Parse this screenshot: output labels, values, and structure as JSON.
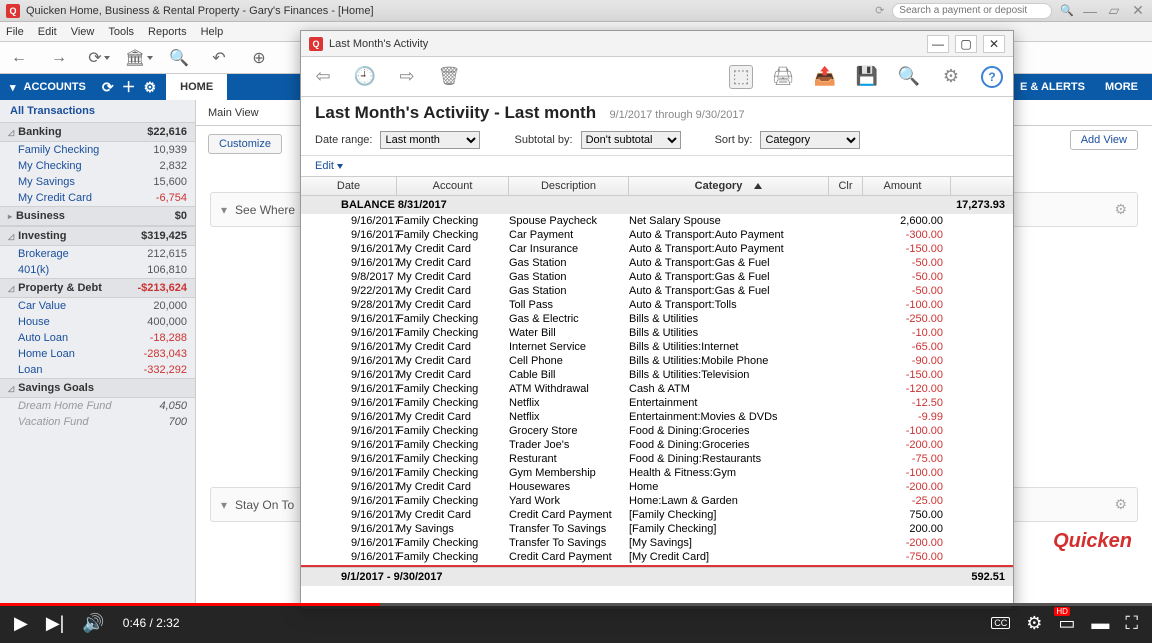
{
  "titlebar": {
    "appTitle": "Quicken Home, Business & Rental Property - Gary's Finances - [Home]",
    "searchPlaceholder": "Search a payment or deposit"
  },
  "menubar": [
    "File",
    "Edit",
    "View",
    "Tools",
    "Reports",
    "Help"
  ],
  "bluenav": {
    "accounts": "ACCOUNTS",
    "home": "HOME",
    "alerts": "E & ALERTS",
    "more": "MORE"
  },
  "mainview": {
    "label": "Main View",
    "customize": "Customize",
    "addview": "Add View"
  },
  "homeSections": {
    "seeWhere": "See Where",
    "stayOnTop": "Stay On To"
  },
  "sidebar": {
    "all": "All Transactions",
    "groups": [
      {
        "name": "Banking",
        "total": "$22,616",
        "rows": [
          {
            "n": "Family Checking",
            "v": "10,939"
          },
          {
            "n": "My Checking",
            "v": "2,832"
          },
          {
            "n": "My Savings",
            "v": "15,600"
          },
          {
            "n": "My Credit Card",
            "v": "-6,754",
            "neg": true
          }
        ]
      },
      {
        "name": "Business",
        "total": "$0",
        "collapsed": true,
        "rows": []
      },
      {
        "name": "Investing",
        "total": "$319,425",
        "rows": [
          {
            "n": "Brokerage",
            "v": "212,615"
          },
          {
            "n": "401(k)",
            "v": "106,810"
          }
        ]
      },
      {
        "name": "Property & Debt",
        "total": "-$213,624",
        "neg": true,
        "rows": [
          {
            "n": "Car Value",
            "v": "20,000"
          },
          {
            "n": "House",
            "v": "400,000"
          },
          {
            "n": "Auto Loan",
            "v": "-18,288",
            "neg": true
          },
          {
            "n": "Home Loan",
            "v": "-283,043",
            "neg": true
          },
          {
            "n": "Loan",
            "v": "-332,292",
            "neg": true
          }
        ]
      },
      {
        "name": "Savings Goals",
        "total": "",
        "rows": [
          {
            "n": "Dream Home Fund",
            "v": "4,050",
            "dim": true
          },
          {
            "n": "Vacation Fund",
            "v": "700",
            "dim": true
          }
        ]
      }
    ]
  },
  "dialog": {
    "title": "Last Month's Activity",
    "heading": "Last Month's Activiity - Last month",
    "range": "9/1/2017 through 9/30/2017",
    "filters": {
      "dateRangeLbl": "Date range:",
      "dateRange": "Last month",
      "subtotalLbl": "Subtotal by:",
      "subtotal": "Don't subtotal",
      "sortLbl": "Sort by:",
      "sort": "Category"
    },
    "editLbl": "Edit",
    "cols": {
      "date": "Date",
      "acct": "Account",
      "desc": "Description",
      "cat": "Category",
      "clr": "Clr",
      "amt": "Amount"
    },
    "balanceLabel": "BALANCE 8/31/2017",
    "balanceAmt": "17,273.93",
    "totalLabel": "9/1/2017 - 9/30/2017",
    "totalAmt": "592.51",
    "rows": [
      {
        "d": "9/16/2017",
        "a": "Family Checking",
        "s": "Spouse Paycheck",
        "c": "Net Salary Spouse",
        "m": "2,600.00"
      },
      {
        "d": "9/16/2017",
        "a": "Family Checking",
        "s": "Car Payment",
        "c": "Auto & Transport:Auto Payment",
        "m": "-300.00",
        "n": 1
      },
      {
        "d": "9/16/2017",
        "a": "My Credit Card",
        "s": "Car Insurance",
        "c": "Auto & Transport:Auto Payment",
        "m": "-150.00",
        "n": 1
      },
      {
        "d": "9/16/2017",
        "a": "My Credit Card",
        "s": "Gas Station",
        "c": "Auto & Transport:Gas & Fuel",
        "m": "-50.00",
        "n": 1
      },
      {
        "d": "9/8/2017",
        "a": "My Credit Card",
        "s": "Gas Station",
        "c": "Auto & Transport:Gas & Fuel",
        "m": "-50.00",
        "n": 1
      },
      {
        "d": "9/22/2017",
        "a": "My Credit Card",
        "s": "Gas Station",
        "c": "Auto & Transport:Gas & Fuel",
        "m": "-50.00",
        "n": 1
      },
      {
        "d": "9/28/2017",
        "a": "My Credit Card",
        "s": "Toll Pass",
        "c": "Auto & Transport:Tolls",
        "m": "-100.00",
        "n": 1
      },
      {
        "d": "9/16/2017",
        "a": "Family Checking",
        "s": "Gas & Electric",
        "c": "Bills & Utilities",
        "m": "-250.00",
        "n": 1
      },
      {
        "d": "9/16/2017",
        "a": "Family Checking",
        "s": "Water Bill",
        "c": "Bills & Utilities",
        "m": "-10.00",
        "n": 1
      },
      {
        "d": "9/16/2017",
        "a": "My Credit Card",
        "s": "Internet Service",
        "c": "Bills & Utilities:Internet",
        "m": "-65.00",
        "n": 1
      },
      {
        "d": "9/16/2017",
        "a": "My Credit Card",
        "s": "Cell Phone",
        "c": "Bills & Utilities:Mobile Phone",
        "m": "-90.00",
        "n": 1
      },
      {
        "d": "9/16/2017",
        "a": "My Credit Card",
        "s": "Cable Bill",
        "c": "Bills & Utilities:Television",
        "m": "-150.00",
        "n": 1
      },
      {
        "d": "9/16/2017",
        "a": "Family Checking",
        "s": "ATM Withdrawal",
        "c": "Cash & ATM",
        "m": "-120.00",
        "n": 1
      },
      {
        "d": "9/16/2017",
        "a": "Family Checking",
        "s": "Netflix",
        "c": "Entertainment",
        "m": "-12.50",
        "n": 1
      },
      {
        "d": "9/16/2017",
        "a": "My Credit Card",
        "s": "Netflix",
        "c": "Entertainment:Movies & DVDs",
        "m": "-9.99",
        "n": 1
      },
      {
        "d": "9/16/2017",
        "a": "Family Checking",
        "s": "Grocery Store",
        "c": "Food & Dining:Groceries",
        "m": "-100.00",
        "n": 1
      },
      {
        "d": "9/16/2017",
        "a": "Family Checking",
        "s": "Trader Joe's",
        "c": "Food & Dining:Groceries",
        "m": "-200.00",
        "n": 1
      },
      {
        "d": "9/16/2017",
        "a": "Family Checking",
        "s": "Resturant",
        "c": "Food & Dining:Restaurants",
        "m": "-75.00",
        "n": 1
      },
      {
        "d": "9/16/2017",
        "a": "Family Checking",
        "s": "Gym Membership",
        "c": "Health & Fitness:Gym",
        "m": "-100.00",
        "n": 1
      },
      {
        "d": "9/16/2017",
        "a": "My Credit Card",
        "s": "Housewares",
        "c": "Home",
        "m": "-200.00",
        "n": 1
      },
      {
        "d": "9/16/2017",
        "a": "Family Checking",
        "s": "Yard Work",
        "c": "Home:Lawn & Garden",
        "m": "-25.00",
        "n": 1
      },
      {
        "d": "9/16/2017",
        "a": "My Credit Card",
        "s": "Credit Card Payment",
        "c": "[Family Checking]",
        "m": "750.00"
      },
      {
        "d": "9/16/2017",
        "a": "My Savings",
        "s": "Transfer To Savings",
        "c": "[Family Checking]",
        "m": "200.00"
      },
      {
        "d": "9/16/2017",
        "a": "Family Checking",
        "s": "Transfer To Savings",
        "c": "[My Savings]",
        "m": "-200.00",
        "n": 1
      },
      {
        "d": "9/16/2017",
        "a": "Family Checking",
        "s": "Credit Card Payment",
        "c": "[My Credit Card]",
        "m": "-750.00",
        "n": 1
      }
    ]
  },
  "brand": "Quicken",
  "video": {
    "cur": "0:46",
    "dur": "2:32"
  }
}
